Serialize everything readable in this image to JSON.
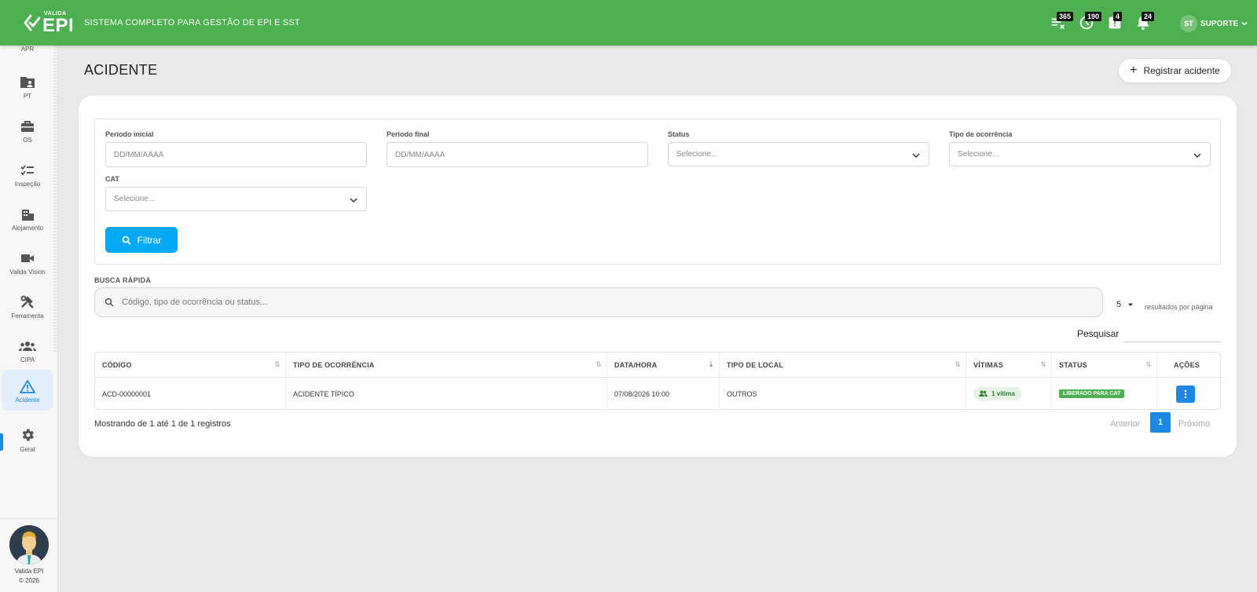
{
  "topbar": {
    "logo_small": "VALIDA",
    "logo_big": "EPI",
    "tagline": "SISTEMA COMPLETO PARA GESTÃO DE EPI E SST",
    "badges": [
      "365",
      "190",
      "4",
      "24"
    ],
    "user_initials": "ST",
    "user_name": "SUPORTE"
  },
  "sidebar": {
    "items": [
      {
        "label": "APR",
        "icon": "clipboard-icon"
      },
      {
        "label": "PT",
        "icon": "folder-user-icon"
      },
      {
        "label": "OS",
        "icon": "briefcase-icon"
      },
      {
        "label": "Inspeção",
        "icon": "checklist-icon"
      },
      {
        "label": "Alojamento",
        "icon": "building-icon"
      },
      {
        "label": "Valida Vision",
        "icon": "video-camera-icon"
      },
      {
        "label": "Ferramenta",
        "icon": "tools-icon"
      },
      {
        "label": "CIPA",
        "icon": "group-icon"
      },
      {
        "label": "Acidente",
        "icon": "warning-icon"
      },
      {
        "label": "Geral",
        "icon": "gear-icon"
      }
    ],
    "footer_line1": "Valida EPI",
    "footer_line2": "© 2026"
  },
  "page": {
    "title": "ACIDENTE",
    "register_label": "Registrar acidente"
  },
  "filters": {
    "periodo_inicial_label": "Período inicial",
    "periodo_inicial_placeholder": "DD/MM/AAAA",
    "periodo_final_label": "Período final",
    "periodo_final_placeholder": "DD/MM/AAAA",
    "status_label": "Status",
    "status_value": "Selecione...",
    "tipo_label": "Tipo de ocorrência",
    "tipo_value": "Selecione...",
    "cat_label": "CAT",
    "cat_value": "Selecione...",
    "filter_button": "Filtrar"
  },
  "search": {
    "label": "BUSCA RÁPIDA",
    "placeholder": "Código, tipo de ocorrência ou status...",
    "per_page": "5",
    "per_page_text": "resultados por página",
    "pesquisar_label": "Pesquisar"
  },
  "table": {
    "headers": [
      "CÓDIGO",
      "TIPO DE OCORRÊNCIA",
      "DATA/HORA",
      "TIPO DE LOCAL",
      "VÍTIMAS",
      "STATUS",
      "AÇÕES"
    ],
    "rows": [
      {
        "codigo": "ACD-00000001",
        "tipo": "ACIDENTE TÍPICO",
        "data_hora": "07/08/2026 10:00",
        "tipo_local": "OUTROS",
        "vitimas": "1 vítima",
        "status": "LIBERADO PARA CAT"
      }
    ]
  },
  "footer": {
    "showing": "Mostrando de 1 até 1 de 1 registros",
    "prev": "Anterior",
    "current_page": "1",
    "next": "Próximo"
  },
  "colors": {
    "topbar": "#4caf50",
    "primary": "#1e88e5",
    "filter_button": "#03a9f4",
    "status_green": "#4caf50"
  }
}
